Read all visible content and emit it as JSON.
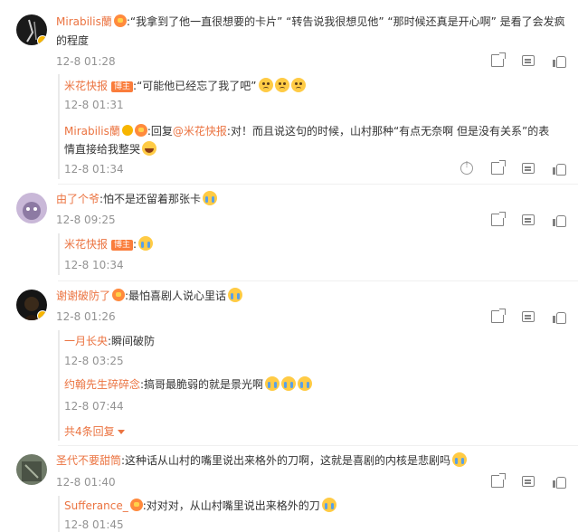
{
  "colors": {
    "username": "#eb7340",
    "timestamp": "#939393",
    "text": "#333333",
    "owner_tag": "#fa7d3c"
  },
  "comments": [
    {
      "user": "Mirabilis蘭",
      "text1": ":“我拿到了他一直很想要的卡片” “转告说我很想见他” “那时候还真是开心啊” 是看了会发疯",
      "text2": "的程度",
      "time": "12-8 01:28",
      "replies": [
        {
          "user": "米花快报",
          "owner_tag": "博主",
          "text": ":“可能他已经忘了我了吧”",
          "time": "12-8 01:31"
        },
        {
          "user": "Mirabilis蘭",
          "prefix": ":回复",
          "mention": "@米花快报",
          "text1": ":对！而且说这句的时候，山村那种“有点无奈啊 但是没有关系”的表",
          "text2": "情直接给我整哭",
          "time": "12-8 01:34"
        }
      ]
    },
    {
      "user": "由了个爷",
      "text": ":怕不是还留着那张卡",
      "time": "12-8 09:25",
      "replies": [
        {
          "user": "米花快报",
          "owner_tag": "博主",
          "text": ":",
          "time": "12-8 10:34"
        }
      ]
    },
    {
      "user": "谢谢破防了",
      "text": ":最怕喜剧人说心里话",
      "time": "12-8 01:26",
      "replies": [
        {
          "user": "一月长央",
          "text": ":瞬间破防",
          "time": "12-8 03:25"
        },
        {
          "user": "约翰先生碎碎念",
          "text": ":搞哥最脆弱的就是景光啊",
          "time": "12-8 07:44"
        }
      ],
      "more_replies": "共4条回复"
    },
    {
      "user": "圣代不要甜筒",
      "text": ":这种话从山村的嘴里说出来格外的刀啊，这就是喜剧的内核是悲剧吗",
      "time": "12-8 01:40",
      "replies": [
        {
          "user": "Sufferance_",
          "text": ":对对对，从山村嘴里说出来格外的刀",
          "time": "12-8 01:45"
        }
      ]
    }
  ],
  "icons": [
    "share-icon",
    "reply-icon",
    "like-icon",
    "report-icon",
    "medal-icon",
    "verified-badge-icon",
    "sad-emoji",
    "cry-emoji",
    "laugh-cry-emoji"
  ]
}
